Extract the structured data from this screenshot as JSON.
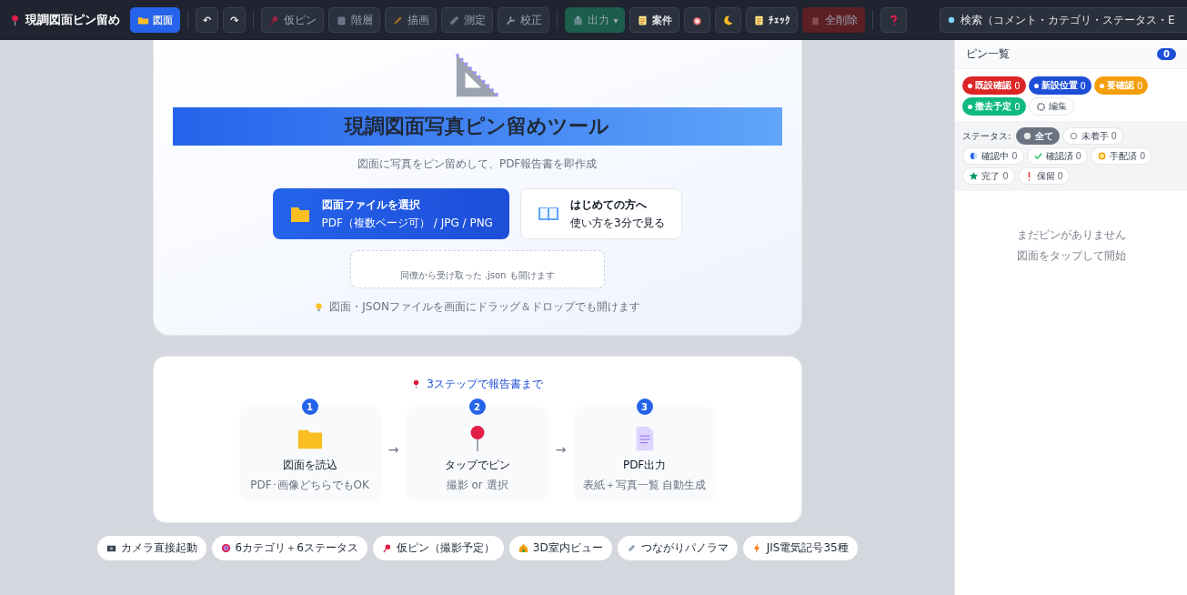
{
  "app": {
    "title": "現調図面ピン留め"
  },
  "toolbar": [
    {
      "kind": "primary",
      "label": "図面",
      "disabled": false
    },
    {
      "kind": "sep"
    },
    {
      "kind": "plain",
      "label": "↶",
      "disabled": false
    },
    {
      "kind": "plain",
      "label": "↷",
      "disabled": false
    },
    {
      "kind": "sep"
    },
    {
      "kind": "plain",
      "label": "仮ピン",
      "disabled": true
    },
    {
      "kind": "plain",
      "label": "階層",
      "disabled": true
    },
    {
      "kind": "plain",
      "label": "描画",
      "disabled": true
    },
    {
      "kind": "plain",
      "label": "測定",
      "disabled": true
    },
    {
      "kind": "plain",
      "label": "校正",
      "disabled": true
    },
    {
      "kind": "sep"
    },
    {
      "kind": "green",
      "label": "出力",
      "caret": "▾",
      "disabled": true
    },
    {
      "kind": "plain",
      "label": "案件",
      "disabled": false
    },
    {
      "kind": "plain",
      "disabled": false
    },
    {
      "kind": "plain",
      "disabled": false
    },
    {
      "kind": "plain",
      "label": "ﾁｪｯｸ",
      "disabled": false
    },
    {
      "kind": "danger",
      "label": "全削除",
      "disabled": true
    },
    {
      "kind": "sep"
    },
    {
      "kind": "plain",
      "disabled": false
    }
  ],
  "search": {
    "placeholder": "検索（コメント・カテゴリ・ステータス・E"
  },
  "hero": {
    "title": "現調図面写真ピン留めツール",
    "subtitle": "図面に写真をピン留めして、PDF報告書を即作成",
    "open_button": {
      "title": "図面ファイルを選択",
      "sub": "PDF（複数ページ可） / JPG / PNG"
    },
    "guide_button": {
      "title": "はじめての方へ",
      "sub": "使い方を3分で見る"
    },
    "json_drop": "同僚から受け取った .json も開けます",
    "hint": "図面・JSONファイルを画面にドラッグ＆ドロップでも開けます"
  },
  "steps": {
    "heading": "3ステップで報告書まで",
    "items": [
      {
        "number": "1",
        "title": "図面を読込",
        "sub": "PDF･画像どちらでもOK"
      },
      {
        "number": "2",
        "title": "タップでピン",
        "sub": "撮影 or 選択"
      },
      {
        "number": "3",
        "title": "PDF出力",
        "sub": "表紙＋写真一覧 自動生成"
      }
    ],
    "arrow": "→"
  },
  "features": [
    {
      "label": "カメラ直接起動"
    },
    {
      "label": "6カテゴリ＋6ステータス"
    },
    {
      "label": "仮ピン（撮影予定）"
    },
    {
      "label": "3D室内ビュー"
    },
    {
      "label": "つながりパノラマ"
    },
    {
      "label": "JIS電気記号35種"
    }
  ],
  "sidebar": {
    "title": "ピン一覧",
    "count": "0",
    "categories": [
      {
        "label": "既設確認",
        "count": "0",
        "color": "#dc2626"
      },
      {
        "label": "新設位置",
        "count": "0",
        "color": "#1d4ed8"
      },
      {
        "label": "要確認",
        "count": "0",
        "color": "#f59e0b"
      },
      {
        "label": "撤去予定",
        "count": "0",
        "color": "#10b981"
      }
    ],
    "edit_button": "編集",
    "status_label": "ステータス:",
    "statuses": [
      {
        "label": "全て",
        "selected": true
      },
      {
        "label": "未着手",
        "count": "0",
        "selected": false
      },
      {
        "label": "確認中",
        "count": "0",
        "selected": false
      },
      {
        "label": "確認済",
        "count": "0",
        "selected": false
      },
      {
        "label": "手配済",
        "count": "0",
        "selected": false
      },
      {
        "label": "完了",
        "count": "0",
        "selected": false
      },
      {
        "label": "保留",
        "count": "0",
        "selected": false
      }
    ],
    "empty": [
      "まだピンがありません",
      "図面をタップして開始"
    ]
  }
}
